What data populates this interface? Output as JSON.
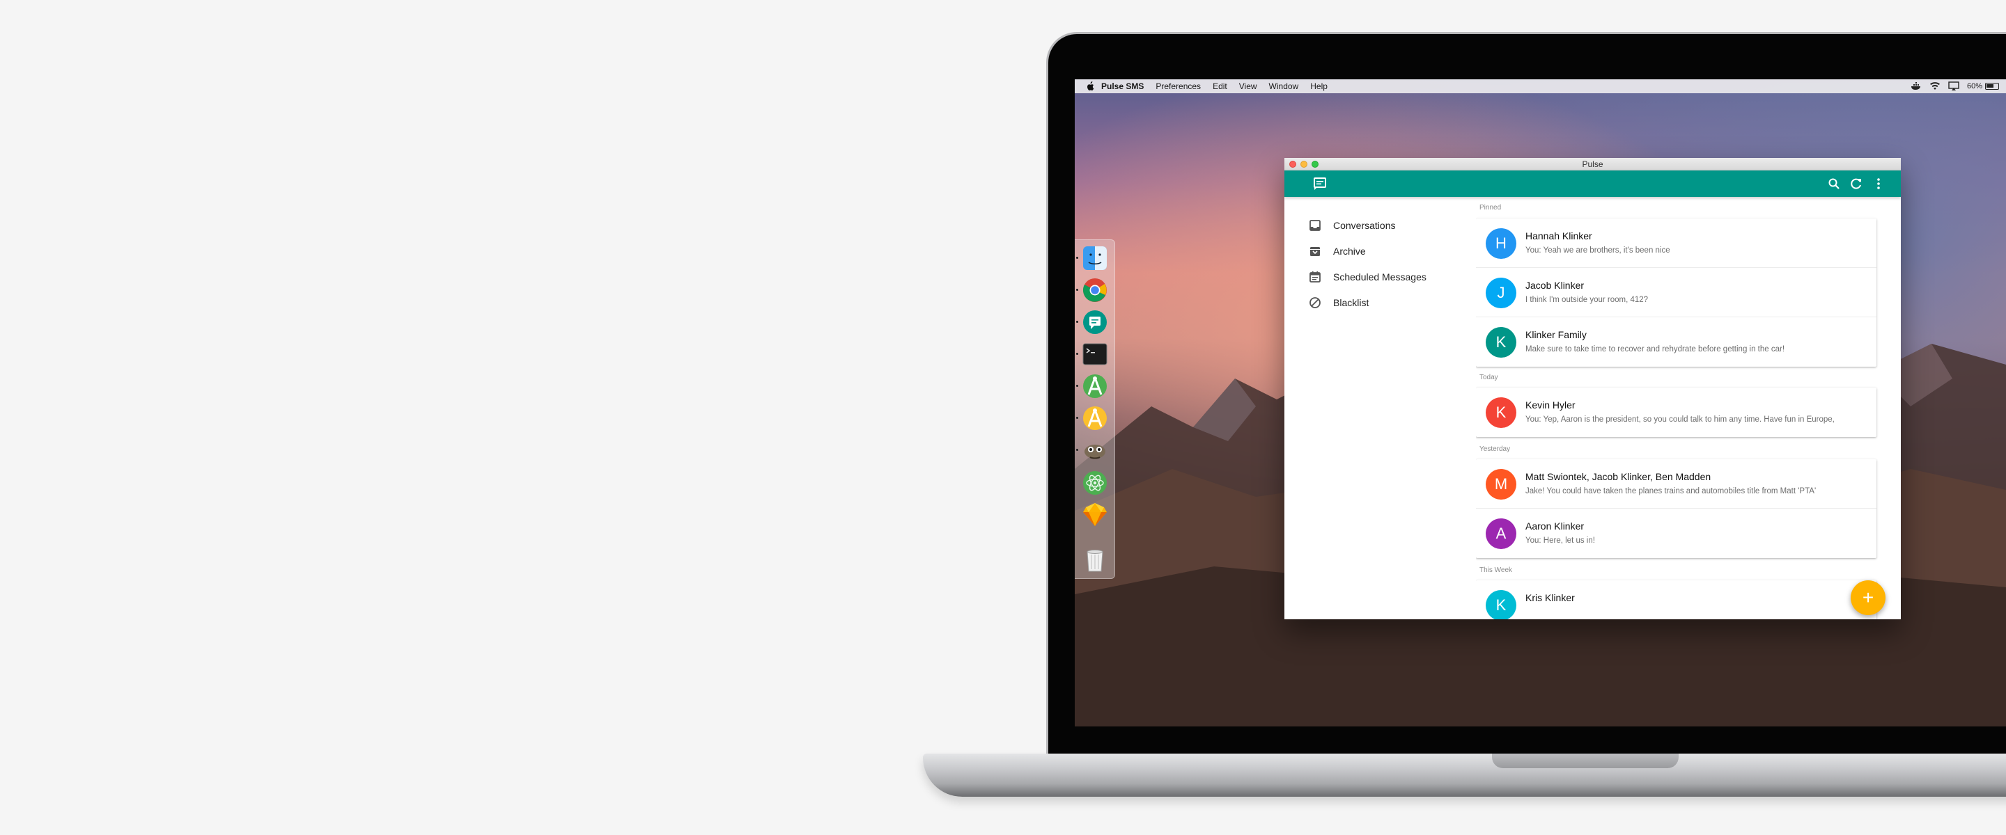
{
  "menubar": {
    "app_name": "Pulse SMS",
    "items": [
      "Preferences",
      "Edit",
      "View",
      "Window",
      "Help"
    ],
    "battery": "60%"
  },
  "window": {
    "title": "Pulse"
  },
  "toolbar": {
    "color": "#009688",
    "icons": [
      "search-icon",
      "refresh-icon",
      "more-vert-icon"
    ]
  },
  "nav": {
    "items": [
      {
        "label": "Conversations",
        "icon": "inbox-icon"
      },
      {
        "label": "Archive",
        "icon": "archive-icon"
      },
      {
        "label": "Scheduled Messages",
        "icon": "calendar-icon"
      },
      {
        "label": "Blacklist",
        "icon": "block-icon"
      }
    ]
  },
  "sections": {
    "pinned": "Pinned",
    "today": "Today",
    "yesterday": "Yesterday",
    "this_week": "This Week"
  },
  "conversations": [
    {
      "initial": "H",
      "name": "Hannah Klinker",
      "snippet": "You: Yeah we are brothers, it's been nice",
      "color": "#2196f3"
    },
    {
      "initial": "J",
      "name": "Jacob Klinker",
      "snippet": "I think I'm outside your room, 412?",
      "color": "#03a9f4"
    },
    {
      "initial": "K",
      "name": "Klinker Family",
      "snippet": "Make sure to take time to recover and rehydrate before getting in the car!",
      "color": "#009688"
    },
    {
      "initial": "K",
      "name": "Kevin Hyler",
      "snippet": "You: Yep, Aaron is the president, so you could talk to him any time. Have fun in Europe,",
      "color": "#f44336"
    },
    {
      "initial": "M",
      "name": "Matt Swiontek, Jacob Klinker, Ben Madden",
      "snippet": "Jake! You could have taken the planes trains and automobiles title from Matt 'PTA'",
      "color": "#ff5722"
    },
    {
      "initial": "A",
      "name": "Aaron Klinker",
      "snippet": "You: Here, let us in!",
      "color": "#9c27b0"
    },
    {
      "initial": "K",
      "name": "Kris Klinker",
      "snippet": "",
      "color": "#00bcd4"
    }
  ],
  "fab": {
    "label": "+",
    "color": "#ffb300"
  },
  "dock": {
    "apps": [
      "finder-icon",
      "chrome-icon",
      "pulse-icon",
      "terminal-icon",
      "android-studio-icon",
      "android-studio-canary-icon",
      "gimp-icon",
      "atom-icon",
      "sketch-icon",
      "trash-icon"
    ]
  }
}
